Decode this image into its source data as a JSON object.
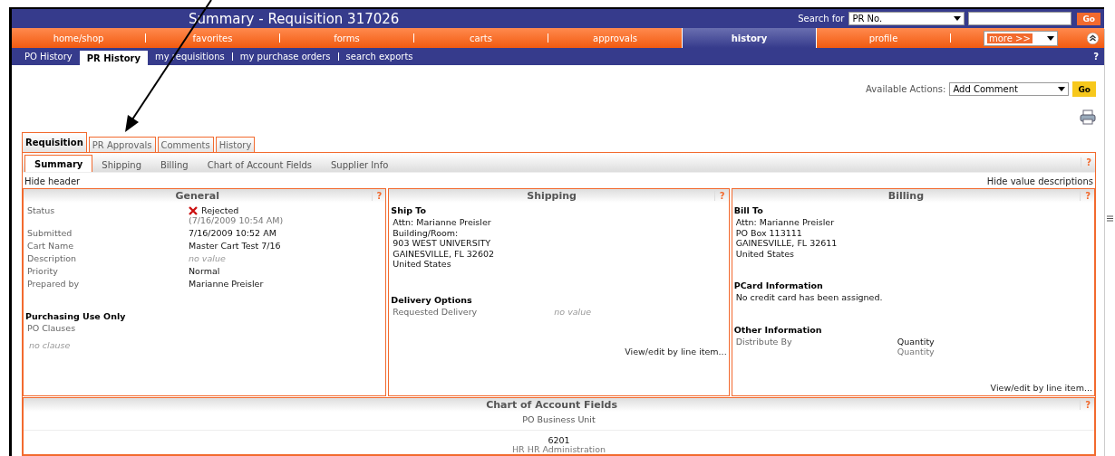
{
  "header": {
    "title": "Summary - Requisition 317026",
    "search_label": "Search for",
    "search_select": "PR No.",
    "search_button": "Go"
  },
  "nav": {
    "items": [
      {
        "label": "home/shop",
        "selected": false
      },
      {
        "label": "favorites",
        "selected": false
      },
      {
        "label": "forms",
        "selected": false
      },
      {
        "label": "carts",
        "selected": false
      },
      {
        "label": "approvals",
        "selected": false
      },
      {
        "label": "history",
        "selected": true
      },
      {
        "label": "profile",
        "selected": false
      }
    ],
    "more": "more >>"
  },
  "subnav": {
    "items": [
      {
        "label": "PO History",
        "selected": false
      },
      {
        "label": "PR History",
        "selected": true
      },
      {
        "label": "my requisitions",
        "selected": false
      },
      {
        "label": "my purchase orders",
        "selected": false
      },
      {
        "label": "search exports",
        "selected": false
      }
    ],
    "help": "?"
  },
  "actions": {
    "label": "Available Actions:",
    "select": "Add Comment",
    "button": "Go"
  },
  "doc_tabs": [
    {
      "label": "Requisition",
      "selected": true
    },
    {
      "label": "PR Approvals",
      "selected": false
    },
    {
      "label": "Comments",
      "selected": false
    },
    {
      "label": "History",
      "selected": false
    }
  ],
  "section_tabs": [
    {
      "label": "Summary",
      "selected": true
    },
    {
      "label": "Shipping",
      "selected": false
    },
    {
      "label": "Billing",
      "selected": false
    },
    {
      "label": "Chart of Account Fields",
      "selected": false
    },
    {
      "label": "Supplier Info",
      "selected": false
    }
  ],
  "section_help": "?",
  "hide_header": "Hide header",
  "hide_descriptions": "Hide value descriptions",
  "general": {
    "title": "General",
    "help": "?",
    "fields": [
      {
        "kind": "status",
        "label": "Status",
        "value": "Rejected",
        "note": "(7/16/2009 10:54 AM)"
      },
      {
        "kind": "text",
        "label": "Submitted",
        "value": "7/16/2009 10:52 AM"
      },
      {
        "kind": "text",
        "label": "Cart Name",
        "value": "Master Cart Test 7/16"
      },
      {
        "kind": "empty",
        "label": "Description",
        "value": "no value"
      },
      {
        "kind": "text",
        "label": "Priority",
        "value": "Normal"
      },
      {
        "kind": "text",
        "label": "Prepared by",
        "value": "Marianne Preisler"
      }
    ],
    "purchasing_title": "Purchasing Use Only",
    "clauses_label": "PO Clauses",
    "clauses_value": "no clause"
  },
  "shipping": {
    "title": "Shipping",
    "help": "?",
    "ship_to_title": "Ship To",
    "address": [
      "Attn: Marianne Preisler",
      "Building/Room:",
      "903 WEST UNIVERSITY",
      "GAINESVILLE, FL 32602",
      "United States"
    ],
    "delivery_title": "Delivery Options",
    "delivery_label": "Requested Delivery",
    "delivery_value": "no value",
    "link": "View/edit by line item..."
  },
  "billing": {
    "title": "Billing",
    "help": "?",
    "bill_to_title": "Bill To",
    "address": [
      "Attn: Marianne Preisler",
      "PO Box 113111",
      "GAINESVILLE, FL 32611",
      "United States"
    ],
    "pcard_title": "PCard Information",
    "pcard_text": "No credit card has been assigned.",
    "other_title": "Other Information",
    "other_label": "Distribute By",
    "other_value": "Quantity",
    "other_note": "Quantity",
    "link": "View/edit by line item..."
  },
  "chart_fields": {
    "title": "Chart of Account Fields",
    "help": "?",
    "column": "PO Business Unit",
    "value": "6201",
    "note": "HR HR Administration"
  }
}
